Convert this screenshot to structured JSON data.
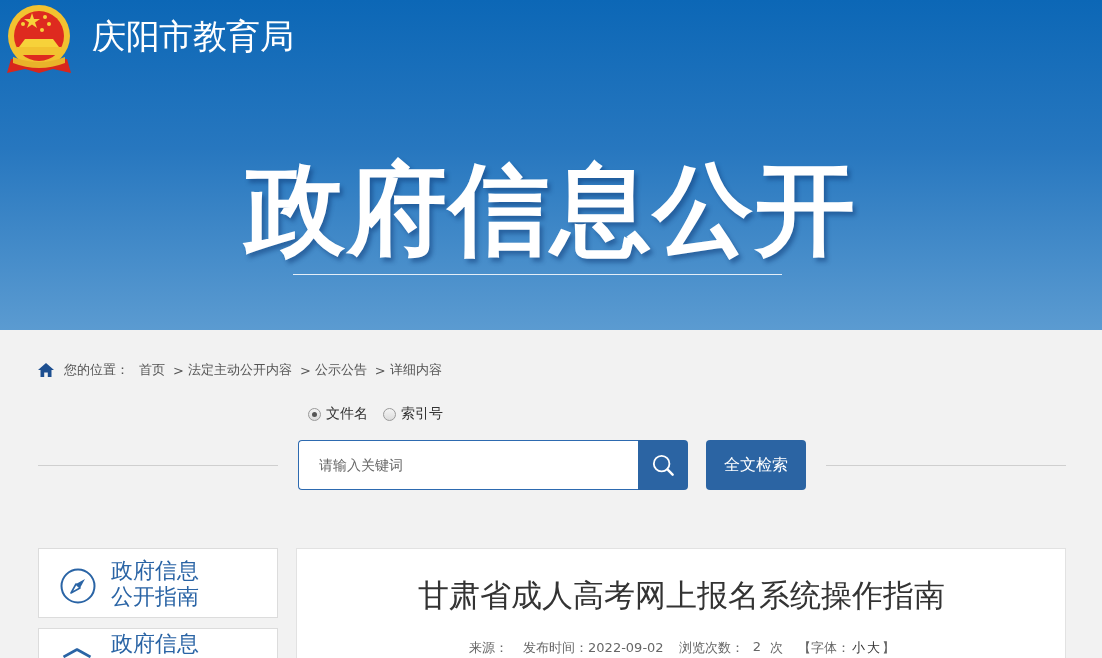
{
  "header": {
    "site_title": "庆阳市教育局",
    "banner_title": "政府信息公开"
  },
  "breadcrumb": {
    "label": "您的位置：",
    "separator": ">",
    "items": [
      "首页",
      "法定主动公开内容",
      "公示公告",
      "详细内容"
    ]
  },
  "search": {
    "scopes": [
      {
        "label": "文件名",
        "selected": true
      },
      {
        "label": "索引号",
        "selected": false
      }
    ],
    "placeholder": "请输入关键词",
    "fulltext_button": "全文检索"
  },
  "sidebar": {
    "items": [
      {
        "kind": "compass",
        "label": "政府信息公开指南"
      },
      {
        "kind": "roof",
        "label": "政府信息"
      }
    ]
  },
  "article": {
    "title": "甘肃省成人高考网上报名系统操作指南",
    "meta": {
      "source_label": "来源：",
      "published": "发布时间：2022-09-02",
      "views_label": "浏览次数：",
      "views": "2",
      "views_unit": "次",
      "font_size": {
        "prefix": "【字体：",
        "options": [
          "小",
          "大"
        ],
        "suffix": "】"
      }
    }
  }
}
